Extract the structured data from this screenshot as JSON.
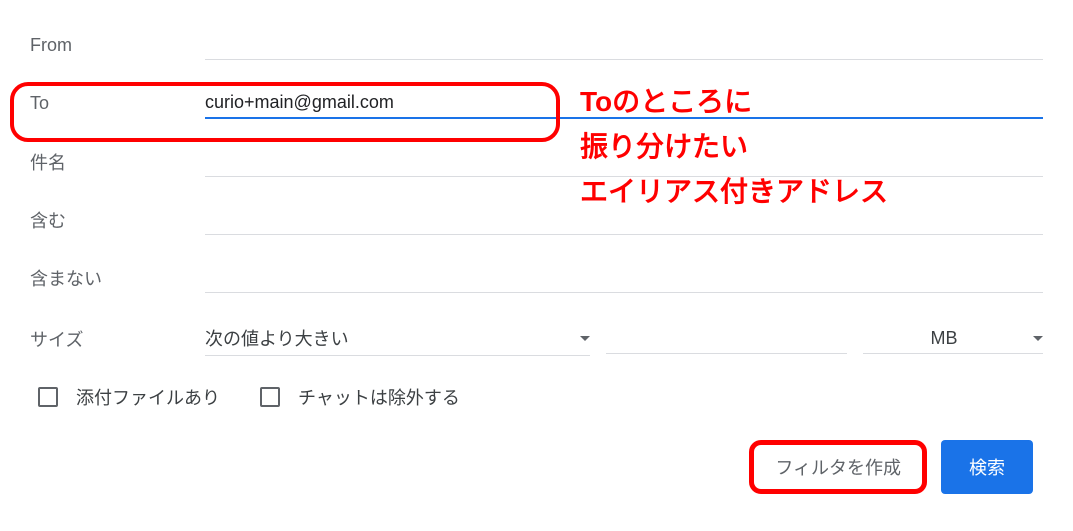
{
  "form": {
    "from": {
      "label": "From",
      "value": ""
    },
    "to": {
      "label": "To",
      "value": "curio+main@gmail.com"
    },
    "subject": {
      "label": "件名",
      "value": ""
    },
    "includes": {
      "label": "含む",
      "value": ""
    },
    "excludes": {
      "label": "含まない",
      "value": ""
    },
    "size": {
      "label": "サイズ",
      "compare": "次の値より大きい",
      "unit": "MB"
    },
    "checkboxes": {
      "hasAttachment": "添付ファイルあり",
      "excludeChat": "チャットは除外する"
    },
    "buttons": {
      "createFilter": "フィルタを作成",
      "search": "検索"
    }
  },
  "annotation": {
    "line1": "Toのところに",
    "line2": "振り分けたい",
    "line3": "エイリアス付きアドレス"
  }
}
